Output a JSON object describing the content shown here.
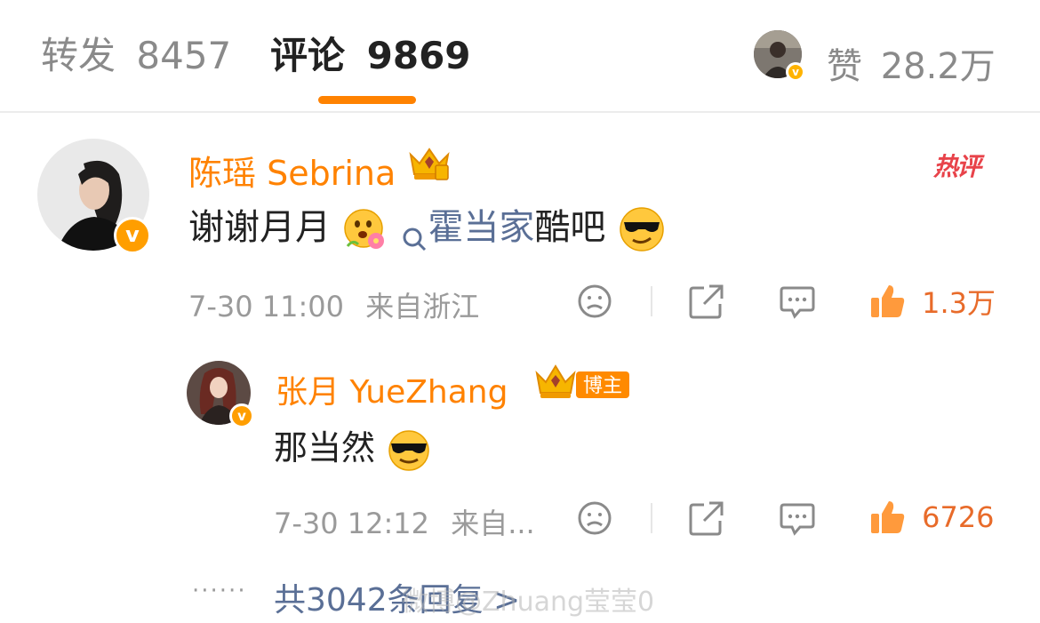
{
  "tabs": [
    {
      "label": "转发",
      "count": "8457"
    },
    {
      "label": "评论",
      "count": "9869"
    }
  ],
  "likes": {
    "label": "赞",
    "count": "28.2万"
  },
  "comment": {
    "author": "陈瑶 Sebrina",
    "hot_badge": "热评",
    "text_before": "谢谢月月",
    "topic": "霍当家",
    "text_after": "酷吧",
    "time": "7-30 11:00",
    "location": "来自浙江",
    "like_count": "1.3万"
  },
  "reply": {
    "author": "张月 YueZhang",
    "tag": "博主",
    "text": "那当然",
    "time": "7-30 12:12",
    "location": "来自...",
    "like_count": "6726"
  },
  "more_replies": {
    "dots": "······",
    "text": "共3042条回复 >"
  },
  "watermark": "微博@Zhuang莹莹0",
  "colors": {
    "accent": "#ff8200",
    "name": "#ff8200",
    "link": "#5a6f96",
    "count": "#e86b2a"
  }
}
